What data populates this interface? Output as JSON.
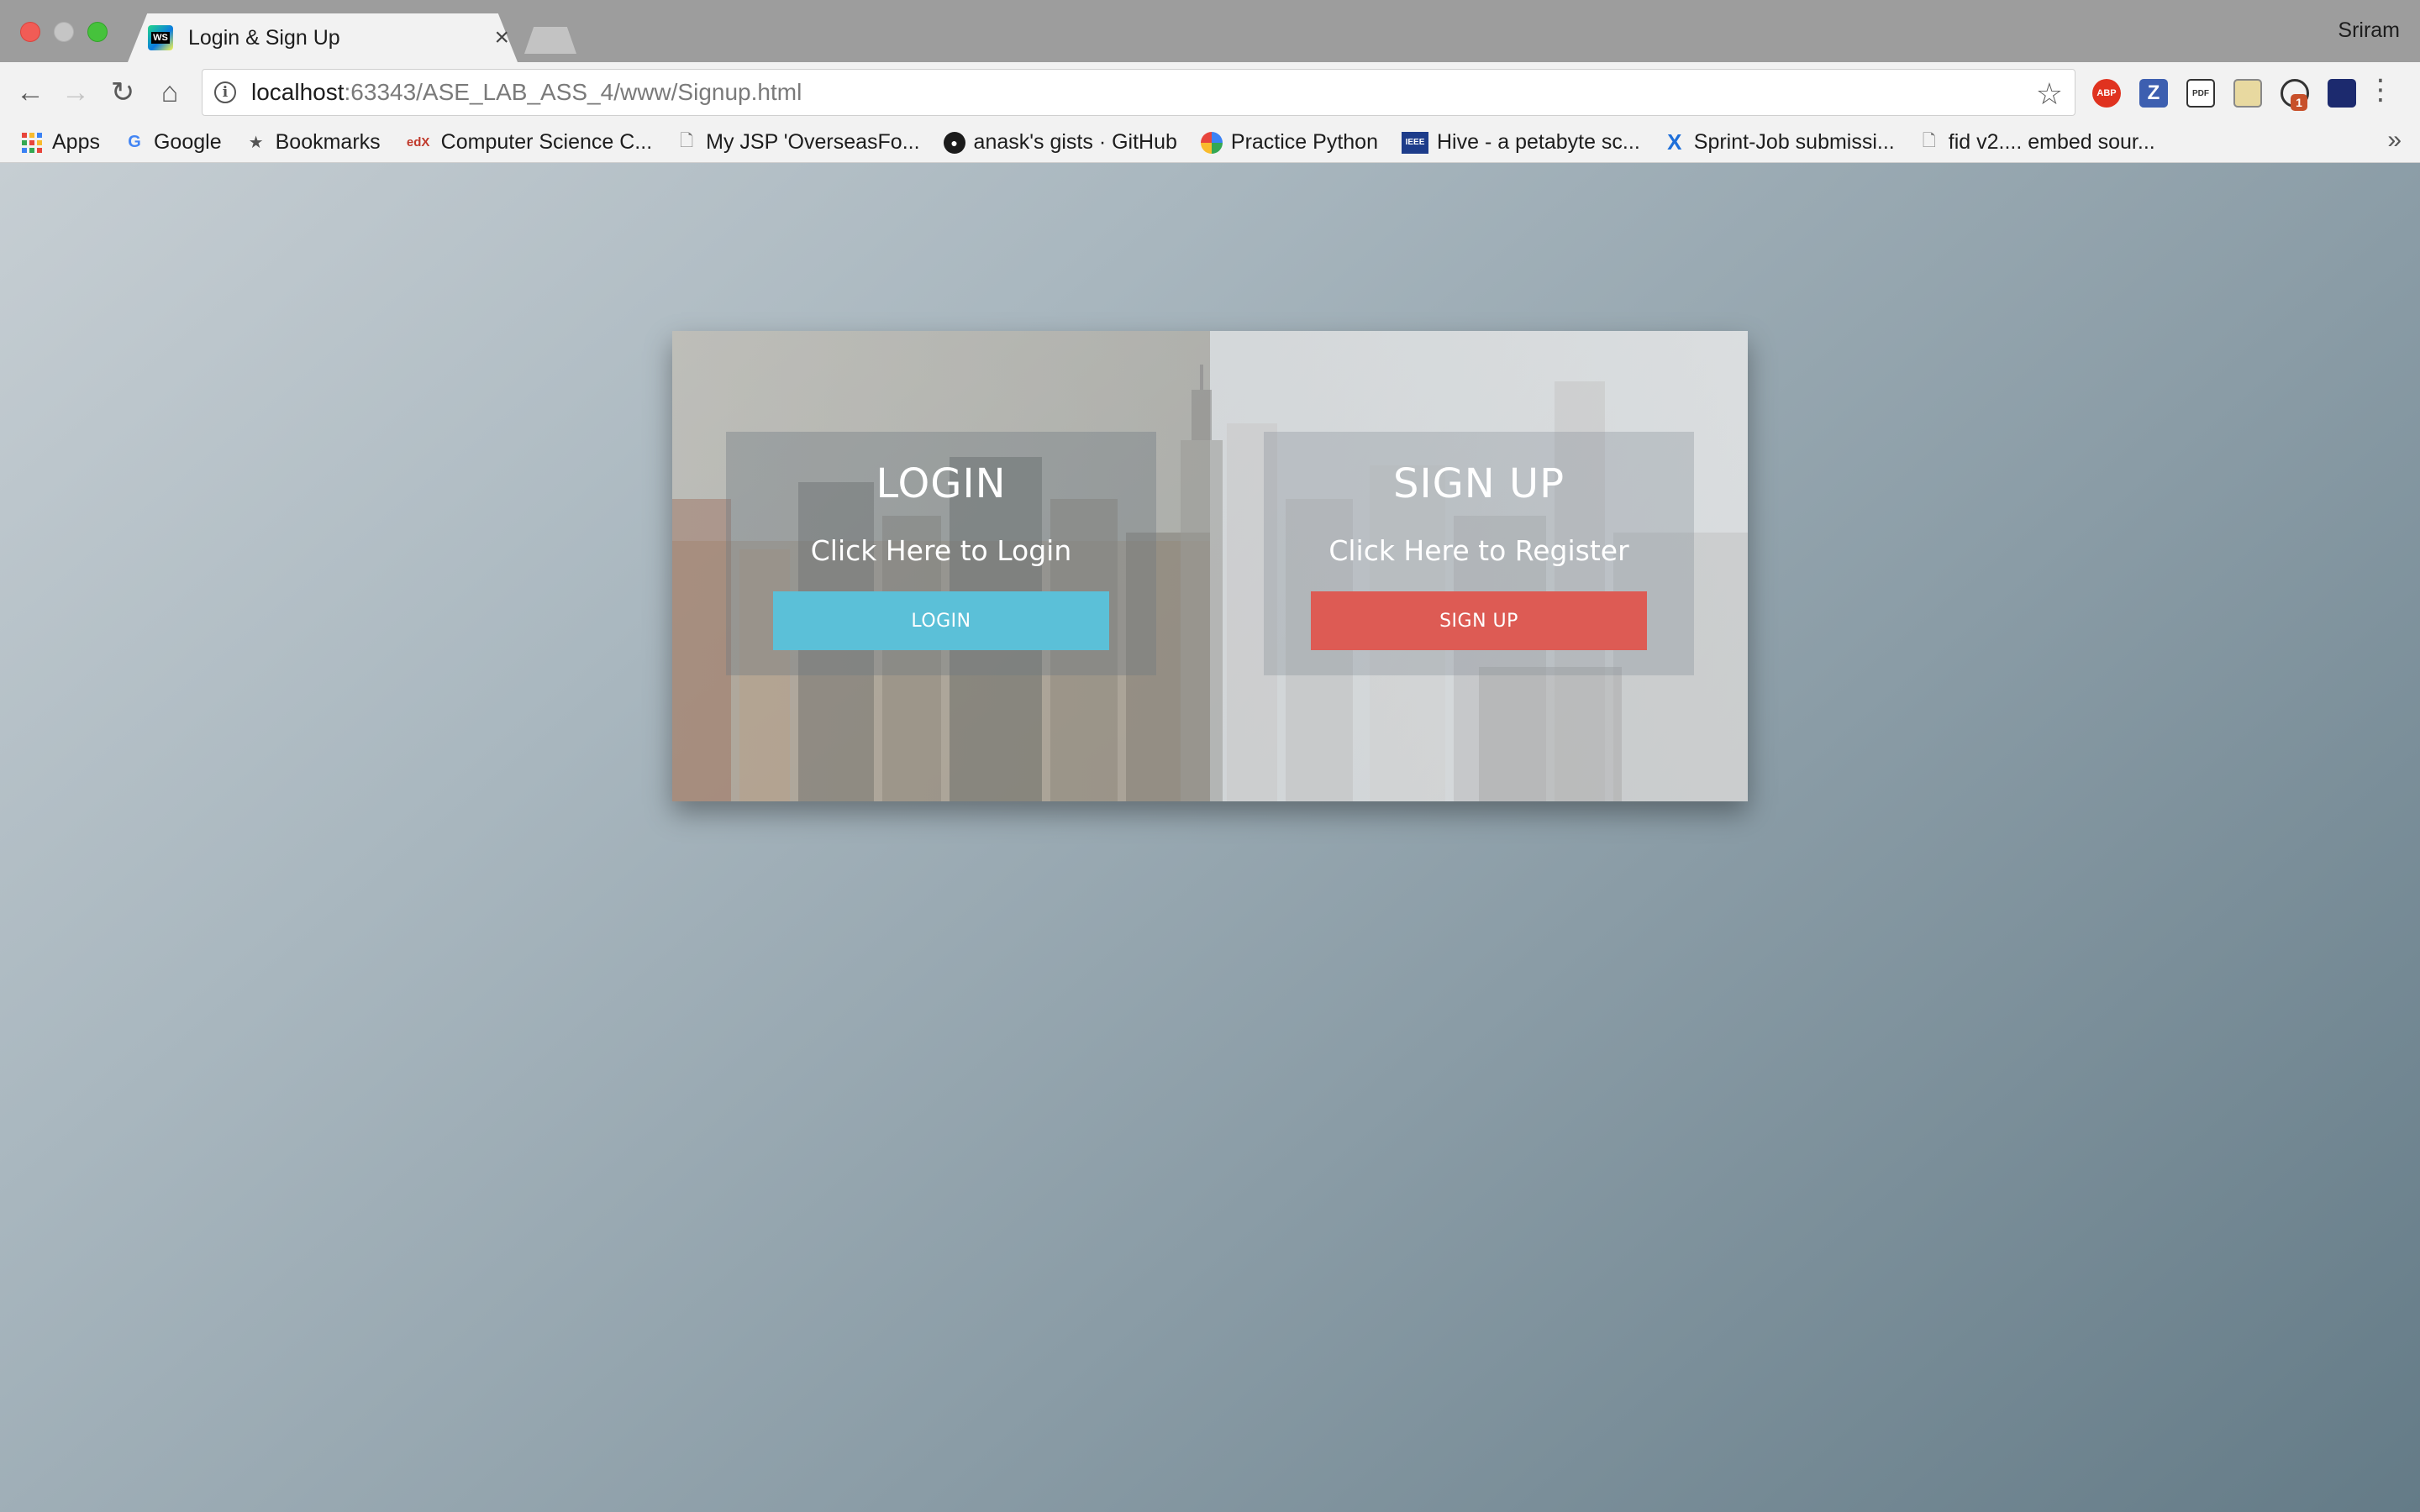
{
  "window": {
    "tab_title": "Login & Sign Up",
    "tab_favicon_text": "WS",
    "profile_name": "Sriram"
  },
  "toolbar": {
    "url_host": "localhost",
    "url_rest": ":63343/ASE_LAB_ASS_4/www/Signup.html",
    "extensions": [
      "ABP",
      "Z",
      "PDF",
      "image",
      "sync",
      "theme"
    ],
    "extension_badge": "1"
  },
  "bookmarks": [
    {
      "label": "Apps",
      "icon": "apps-grid-icon"
    },
    {
      "label": "Google",
      "icon": "google-icon"
    },
    {
      "label": "Bookmarks",
      "icon": "star-icon"
    },
    {
      "label": "Computer Science C...",
      "icon": "edx-icon"
    },
    {
      "label": "My JSP 'OverseasFo...",
      "icon": "page-icon"
    },
    {
      "label": "anask's gists · GitHub",
      "icon": "github-icon"
    },
    {
      "label": "Practice Python",
      "icon": "python-icon"
    },
    {
      "label": "Hive - a petabyte sc...",
      "icon": "ieee-icon"
    },
    {
      "label": "Sprint-Job submissi...",
      "icon": "x-icon"
    },
    {
      "label": "fid v2.... embed sour...",
      "icon": "page-icon"
    }
  ],
  "login_panel": {
    "heading": "LOGIN",
    "subtitle": "Click Here to Login",
    "button_label": "LOGIN",
    "button_color": "#5bc0d8"
  },
  "signup_panel": {
    "heading": "SIGN UP",
    "subtitle": "Click Here to Register",
    "button_label": "SIGN UP",
    "button_color": "#dd5b54"
  }
}
